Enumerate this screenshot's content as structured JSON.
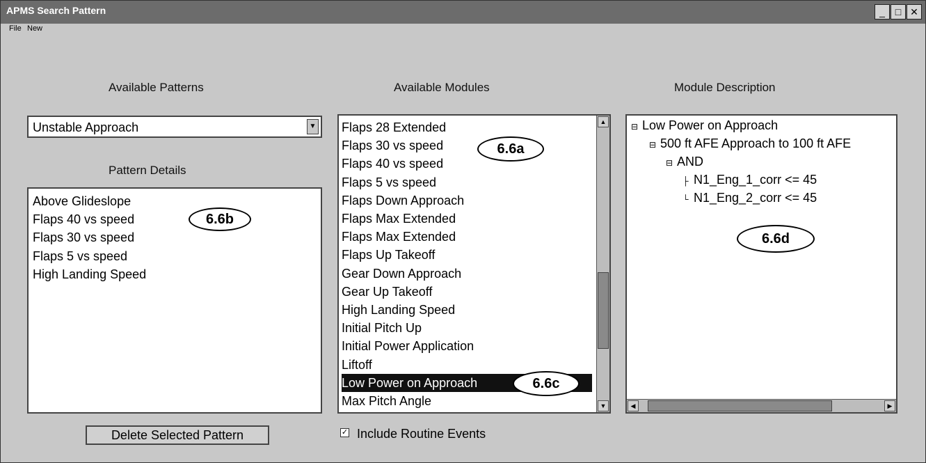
{
  "window": {
    "title": "APMS Search Pattern",
    "buttons": {
      "minimize": "_",
      "maximize": "□",
      "close": "✕"
    }
  },
  "menu": {
    "file": "File",
    "new": "New"
  },
  "headings": {
    "available_patterns": "Available Patterns",
    "pattern_details": "Pattern Details",
    "available_modules": "Available Modules",
    "module_description": "Module Description"
  },
  "patterns": {
    "selected": "Unstable Approach"
  },
  "pattern_details": {
    "items": [
      "Above Glideslope",
      "Flaps 40 vs speed",
      "Flaps 30 vs speed",
      "Flaps 5 vs speed",
      "High Landing Speed"
    ]
  },
  "modules": {
    "items": [
      "Flaps 28 Extended",
      "Flaps 30 vs speed",
      "Flaps 40 vs speed",
      "Flaps 5 vs speed",
      "Flaps Down Approach",
      "Flaps Max Extended",
      "Flaps Max Extended",
      "Flaps Up Takeoff",
      "Gear Down Approach",
      "Gear Up Takeoff",
      "High Landing Speed",
      "Initial Pitch Up",
      "Initial Power Application",
      "Liftoff",
      "Low Power on Approach",
      "Max Pitch Angle"
    ],
    "selected_item": "Low Power on Approach"
  },
  "description_tree": {
    "root": "Low Power on Approach",
    "child": "500 ft AFE Approach to 100 ft AFE",
    "op": "AND",
    "cond1": "N1_Eng_1_corr <= 45",
    "cond2": "N1_Eng_2_corr <= 45"
  },
  "annotations": {
    "a": "6.6a",
    "b": "6.6b",
    "c": "6.6c",
    "d": "6.6d"
  },
  "buttons": {
    "delete": "Delete Selected Pattern"
  },
  "checkbox": {
    "label": "Include Routine Events",
    "checked": true,
    "mark": "✓"
  },
  "icons": {
    "scroll_up": "▲",
    "scroll_down": "▼",
    "scroll_left": "◀",
    "scroll_right": "▶",
    "dropdown": "▼",
    "tree_collapse": "⊟"
  }
}
